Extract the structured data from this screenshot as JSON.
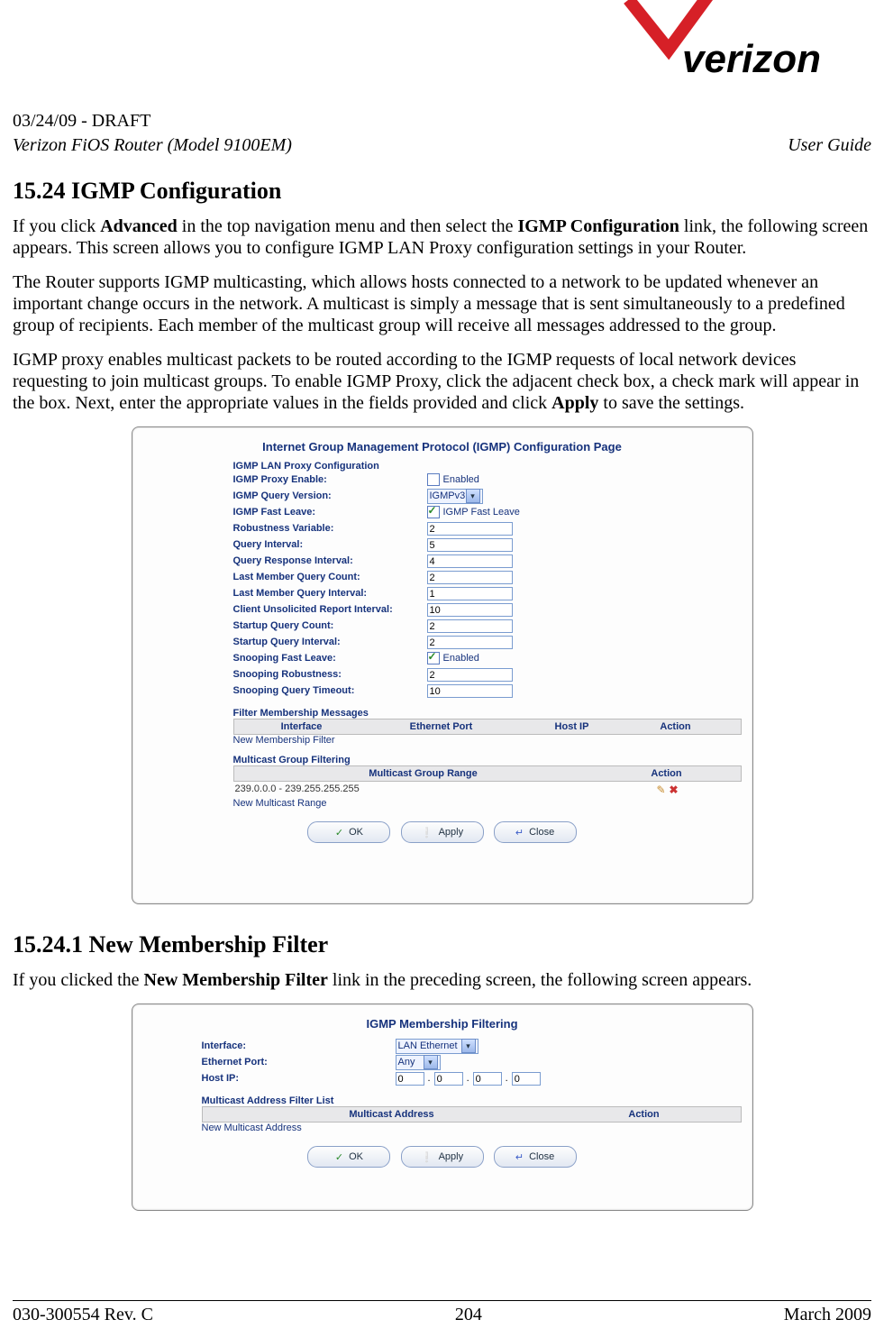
{
  "header": {
    "date_draft": "03/24/09 - DRAFT",
    "product": "Verizon FiOS Router (Model 9100EM)",
    "doc_type": "User Guide"
  },
  "s1_title": "15.24   IGMP Configuration",
  "p1a": "If you click ",
  "p1b": "Advanced",
  "p1c": " in the top navigation menu and then select the ",
  "p1d": "IGMP Configuration",
  "p1e": " link, the following screen appears. This screen allows you to configure IGMP LAN Proxy configuration settings in your Router.",
  "p2": "The Router supports IGMP multicasting, which allows hosts connected to a network to be updated whenever an important change occurs in the network. A multicast is simply a message that is sent simultaneously to a predefined group of recipients. Each member of the multicast group will receive all messages addressed to the group.",
  "p3a": "IGMP proxy enables multicast packets to be routed according to the IGMP requests of local network devices requesting to join multicast groups. To enable IGMP Proxy, click the adjacent check box, a check mark will appear in the box. Next, enter the appropriate values in the fields provided and click ",
  "p3b": "Apply",
  "p3c": " to save the settings.",
  "panel1": {
    "title": "Internet Group Management Protocol (IGMP) Configuration Page",
    "sec1": "IGMP LAN Proxy Configuration",
    "rows": {
      "proxy_enable": {
        "label": "IGMP Proxy Enable:",
        "text": "Enabled",
        "checked": false
      },
      "query_version": {
        "label": "IGMP Query Version:",
        "value": "IGMPv3"
      },
      "fast_leave": {
        "label": "IGMP Fast Leave:",
        "text": "IGMP Fast Leave",
        "checked": true
      },
      "robustness": {
        "label": "Robustness Variable:",
        "value": "2"
      },
      "query_interval": {
        "label": "Query Interval:",
        "value": "5"
      },
      "query_resp": {
        "label": "Query Response Interval:",
        "value": "4"
      },
      "lm_count": {
        "label": "Last Member Query Count:",
        "value": "2"
      },
      "lm_interval": {
        "label": "Last Member Query Interval:",
        "value": "1"
      },
      "unsolicited": {
        "label": "Client Unsolicited Report Interval:",
        "value": "10"
      },
      "startup_count": {
        "label": "Startup Query Count:",
        "value": "2"
      },
      "startup_interval": {
        "label": "Startup Query Interval:",
        "value": "2"
      },
      "snoop_fast": {
        "label": "Snooping Fast Leave:",
        "text": "Enabled",
        "checked": true
      },
      "snoop_robust": {
        "label": "Snooping Robustness:",
        "value": "2"
      },
      "snoop_timeout": {
        "label": "Snooping Query Timeout:",
        "value": "10"
      }
    },
    "filter_head": "Filter Membership Messages",
    "filter_cols": {
      "c1": "Interface",
      "c2": "Ethernet Port",
      "c3": "Host IP",
      "c4": "Action"
    },
    "new_filter_link": "New Membership Filter",
    "mgroup_head": "Multicast Group Filtering",
    "mgroup_cols": {
      "c1": "Multicast Group Range",
      "c2": "Action"
    },
    "mgroup_row": "239.0.0.0 - 239.255.255.255",
    "new_range_link": "New Multicast Range",
    "buttons": {
      "ok": "OK",
      "apply": "Apply",
      "close": "Close"
    }
  },
  "s2_title": "15.24.1       New Membership Filter",
  "p4a": "If you clicked the ",
  "p4b": "New Membership Filter",
  "p4c": " link in the preceding screen, the following screen appears.",
  "panel2": {
    "title": "IGMP Membership Filtering",
    "rows": {
      "interface": {
        "label": "Interface:",
        "value": "LAN Ethernet"
      },
      "port": {
        "label": "Ethernet Port:",
        "value": "Any"
      },
      "host": {
        "label": "Host IP:",
        "o1": "0",
        "o2": "0",
        "o3": "0",
        "o4": "0"
      }
    },
    "list_head": "Multicast Address Filter List",
    "list_cols": {
      "c1": "Multicast Address",
      "c2": "Action"
    },
    "new_addr_link": "New Multicast Address",
    "buttons": {
      "ok": "OK",
      "apply": "Apply",
      "close": "Close"
    }
  },
  "footer": {
    "left": "030-300554 Rev. C",
    "center": "204",
    "right": "March 2009"
  }
}
